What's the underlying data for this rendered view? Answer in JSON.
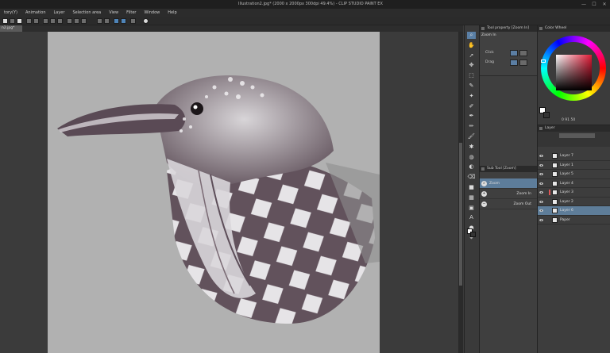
{
  "window": {
    "title": "Illustration2.jpg* (2000 x 2000px 300dpi 49.4%) - CLIP STUDIO PAINT EX",
    "minimize": "—",
    "maximize": "☐",
    "close": "✕"
  },
  "menu": [
    "tory(Y)",
    "Animation",
    "Layer",
    "Selection area",
    "View",
    "Filter",
    "Window",
    "Help"
  ],
  "document_tab": "n2.jpg*",
  "tool_property": {
    "tab_label": "Tool property [Zoom In]",
    "title": "Zoom In",
    "rows": [
      {
        "label": "Click"
      },
      {
        "label": "Drag"
      }
    ]
  },
  "sub_tool": {
    "tab_label": "Sub Tool [Zoom]",
    "items": [
      {
        "label": "Zoom",
        "selected": true
      },
      {
        "label": "Zoom In",
        "selected": false
      },
      {
        "label": "Zoom Out",
        "selected": false
      }
    ]
  },
  "color": {
    "tab_label": "Color Wheel",
    "main_color": "#ffffff",
    "sub_color": "#333333",
    "hue_color": "#e11a36",
    "hsv": "0   91   50"
  },
  "layers": {
    "tab_label": "Layer",
    "items": [
      {
        "name": "Layer 7",
        "visible": true,
        "selected": false
      },
      {
        "name": "Layer 1",
        "visible": true,
        "selected": false
      },
      {
        "name": "Layer 5",
        "visible": true,
        "selected": false
      },
      {
        "name": "Layer 4",
        "visible": true,
        "selected": false
      },
      {
        "name": "Layer 3",
        "visible": true,
        "selected": false
      },
      {
        "name": "Layer 2",
        "visible": true,
        "selected": false
      },
      {
        "name": "Layer 6",
        "visible": true,
        "selected": true
      },
      {
        "name": "Paper",
        "visible": true,
        "selected": false
      }
    ]
  },
  "tools": [
    {
      "icon": "⌕",
      "name": "zoom-tool-icon",
      "active": true
    },
    {
      "icon": "✋",
      "name": "hand-tool-icon"
    },
    {
      "icon": "➚",
      "name": "operation-tool-icon"
    },
    {
      "icon": "✥",
      "name": "move-layer-icon"
    },
    {
      "icon": "⬚",
      "name": "selection-tool-icon"
    },
    {
      "icon": "✎",
      "name": "lasso-icon"
    },
    {
      "icon": "✦",
      "name": "auto-select-icon"
    },
    {
      "icon": "✐",
      "name": "eyedropper-icon"
    },
    {
      "icon": "✒",
      "name": "pen-icon"
    },
    {
      "icon": "✏",
      "name": "pencil-icon"
    },
    {
      "icon": "🖌",
      "name": "brush-icon"
    },
    {
      "icon": "✱",
      "name": "airbrush-icon"
    },
    {
      "icon": "◍",
      "name": "decoration-icon"
    },
    {
      "icon": "◐",
      "name": "blend-icon"
    },
    {
      "icon": "⌫",
      "name": "eraser-icon"
    },
    {
      "icon": "■",
      "name": "fill-icon"
    },
    {
      "icon": "▦",
      "name": "gradient-icon"
    },
    {
      "icon": "▣",
      "name": "figure-icon"
    },
    {
      "icon": "A",
      "name": "text-icon"
    },
    {
      "icon": "●",
      "name": "balloon-icon"
    },
    {
      "icon": "⌖",
      "name": "ruler-icon"
    }
  ]
}
